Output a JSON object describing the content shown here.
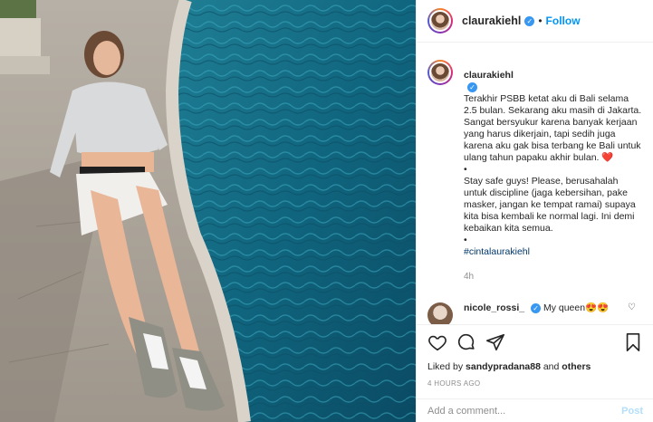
{
  "post": {
    "username": "claurakiehl",
    "follow_label": "Follow",
    "separator": "•"
  },
  "caption": {
    "username": "claurakiehl",
    "text": "Terakhir PSBB ketat aku di Bali selama 2.5 bulan. Sekarang aku masih di Jakarta. Sangat bersyukur karena banyak kerjaan yang harus dikerjain, tapi sedih juga karena aku gak bisa terbang ke Bali untuk ulang tahun papaku akhir bulan. ❤️\n•\nStay safe guys! Please, berusahalah untuk discipline (jaga kebersihan, pake masker, jangan ke tempat ramai) supaya kita bisa kembali ke normal lagi. Ini demi kebaikan kita semua.\n•",
    "hashtag": "#cintalaurakiehl",
    "time": "4h"
  },
  "comment": {
    "username": "nicole_rossi_",
    "text": "My queen😍😍"
  },
  "likes": {
    "prefix": "Liked by",
    "user": "sandypradana88",
    "connector": "and",
    "others": "others"
  },
  "posted_time": "4 HOURS AGO",
  "add_comment": {
    "placeholder": "Add a comment...",
    "post_label": "Post"
  },
  "colors": {
    "accent": "#0095f6",
    "verified": "#3897f0",
    "post_disabled": "#b2dffc",
    "heart": "#d1203a"
  },
  "icons": [
    "verified-badge-icon",
    "heart-icon",
    "comment-icon",
    "share-icon",
    "save-icon"
  ]
}
